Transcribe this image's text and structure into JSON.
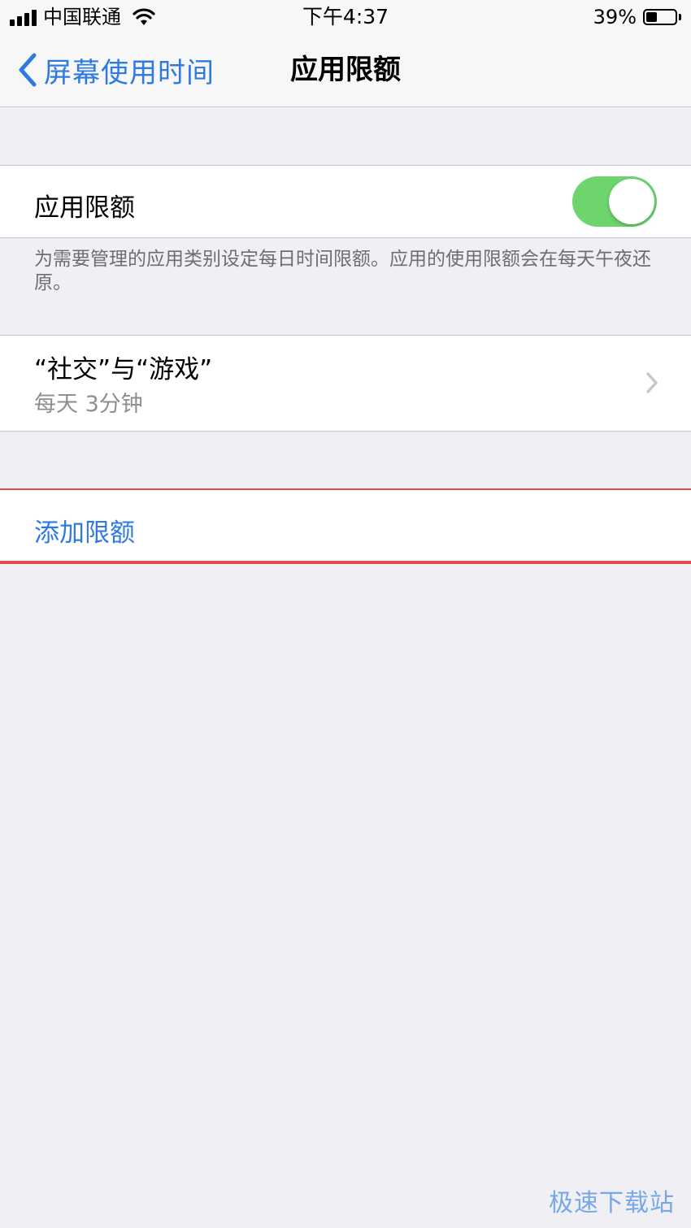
{
  "status_bar": {
    "carrier": "中国联通",
    "time": "下午4:37",
    "battery_percent": "39%",
    "battery_level": 0.39,
    "signal_icon": "cellular-signal-icon",
    "wifi_icon": "wifi-icon",
    "battery_icon": "battery-icon"
  },
  "nav": {
    "back_label": "屏幕使用时间",
    "title": "应用限额",
    "back_icon": "chevron-left-icon"
  },
  "app_limits": {
    "toggle_label": "应用限额",
    "toggle_on": true,
    "footer": "为需要管理的应用类别设定每日时间限额。应用的使用限额会在每天午夜还原。"
  },
  "limit_item": {
    "title": "“社交”与“游戏”",
    "subtitle": "每天 3分钟",
    "chevron_icon": "chevron-right-icon"
  },
  "add_limit": {
    "label": "添加限额"
  },
  "colors": {
    "ios_blue": "#2f7ae0",
    "toggle_green": "#6dd46e",
    "highlight_red": "#e04a55",
    "background": "#efeff4"
  },
  "watermark": "极速下载站"
}
